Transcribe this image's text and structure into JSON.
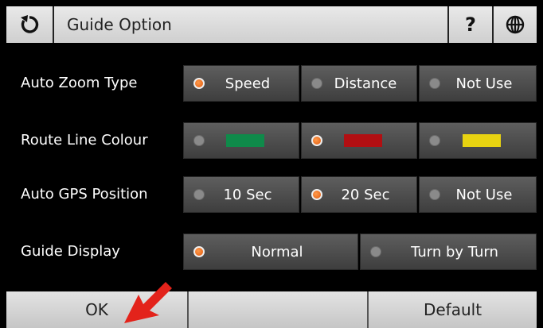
{
  "header": {
    "title": "Guide Option",
    "help": "?"
  },
  "rows": [
    {
      "label": "Auto Zoom Type",
      "options": [
        {
          "label": "Speed",
          "selected": true
        },
        {
          "label": "Distance",
          "selected": false
        },
        {
          "label": "Not Use",
          "selected": false
        }
      ]
    },
    {
      "label": "Route Line Colour",
      "options": [
        {
          "color": "#0f8a4a",
          "selected": false
        },
        {
          "color": "#b10f12",
          "selected": true
        },
        {
          "color": "#e8d311",
          "selected": false
        }
      ]
    },
    {
      "label": "Auto GPS Position",
      "options": [
        {
          "label": "10 Sec",
          "selected": false
        },
        {
          "label": "20 Sec",
          "selected": true
        },
        {
          "label": "Not Use",
          "selected": false
        }
      ]
    },
    {
      "label": "Guide Display",
      "options": [
        {
          "label": "Normal",
          "selected": true
        },
        {
          "label": "Turn by Turn",
          "selected": false
        }
      ]
    }
  ],
  "footer": {
    "ok": "OK",
    "middle": "",
    "default": "Default"
  },
  "colors": {
    "selected_radio": "#e86a1c",
    "arrow": "#e3231b"
  },
  "icons": {
    "back": "refresh-back-icon",
    "globe": "globe-icon",
    "pointer": "red-arrow-pointer"
  }
}
